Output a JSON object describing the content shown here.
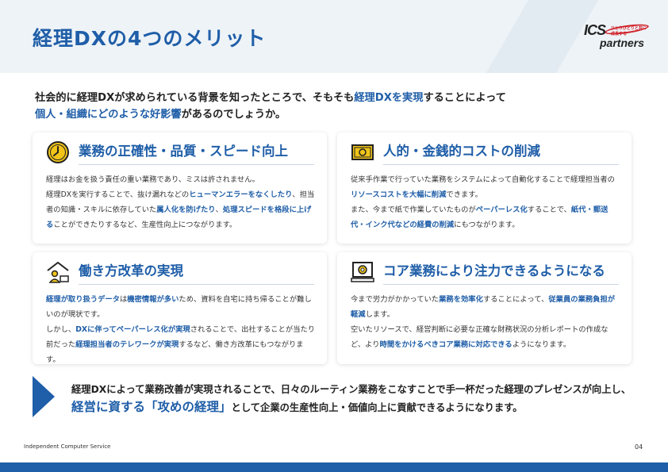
{
  "header": {
    "title": "経理DXの4つのメリット",
    "logo_main": "ICS",
    "logo_sub": "partners",
    "logo_tag": "ひとりひとりと共に成長する"
  },
  "intro": {
    "line1_a": "社会的に経理DXが求められている背景を知ったところで、そもそも",
    "line1_hl": "経理DXを実現",
    "line1_b": "することによって",
    "line2_hl": "個人・組織にどのような好影響",
    "line2_b": "があるのでしょうか。"
  },
  "cards": [
    {
      "icon": "clock-icon",
      "title": "業務の正確性・品質・スピード向上",
      "p1": "経理はお金を扱う責任の重い業務であり、ミスは許されません。",
      "p2_a": "経理DXを実行することで、抜け漏れなどの",
      "p2_em1": "ヒューマンエラーをなくしたり",
      "p2_b": "、担当者の知識・スキルに依存していた",
      "p2_em2": "属人化を防げたり",
      "p2_c": "、",
      "p2_em3": "処理スピードを格段に上げる",
      "p2_d": "ことができたりするなど、生産性向上につながります。"
    },
    {
      "icon": "money-icon",
      "title": "人的・金銭的コストの削減",
      "p1_a": "従来手作業で行っていた業務をシステムによって自動化することで経理担当者の",
      "p1_em": "リソースコストを大幅に削減",
      "p1_b": "できます。",
      "p2_a": "また、今まで紙で作業していたものが",
      "p2_em1": "ペーパーレス化",
      "p2_b": "することで、",
      "p2_em2": "紙代・郵送代・インク代などの経費の削減",
      "p2_c": "にもつながります。"
    },
    {
      "icon": "home-work-icon",
      "title": "働き方改革の実現",
      "p1_em1": "経理が取り扱うデータ",
      "p1_a": "は",
      "p1_em2": "機密情報が多い",
      "p1_b": "ため、資料を自宅に持ち帰ることが難しいのが現状です。",
      "p2_a": "しかし、",
      "p2_em1": "DXに伴ってペーパーレス化が実現",
      "p2_b": "されることで、出社することが当たり前だった",
      "p2_em2": "経理担当者のテレワークが実現",
      "p2_c": "するなど、働き方改革にもつながります。"
    },
    {
      "icon": "computer-gear-icon",
      "title": "コア業務により注力できるようになる",
      "p1_a": "今まで労力がかかっていた",
      "p1_em1": "業務を効率化",
      "p1_b": "することによって、",
      "p1_em2": "従業員の業務負担が軽減",
      "p1_c": "します。",
      "p2_a": "空いたリソースで、経営判断に必要な正確な財務状況の分析レポートの作成など、より",
      "p2_em": "時間をかけるべきコア業務に対応できる",
      "p2_b": "ようになります。"
    }
  ],
  "conclusion": {
    "line1": "経理DXによって業務改善が実現されることで、日々のルーティン業務をこなすことで手一杯だった経理のプレゼンスが向上し、",
    "line2_hl": "経営に資する「攻めの経理」",
    "line2_b": "として企業の生産性向上・価値向上に貢献できるようになります。"
  },
  "footer": {
    "company": "Independent Computer Service",
    "page": "04"
  },
  "colors": {
    "accent": "#1f5ea8",
    "icon_yellow": "#f0c419",
    "header_bg": "#eef3f7"
  }
}
